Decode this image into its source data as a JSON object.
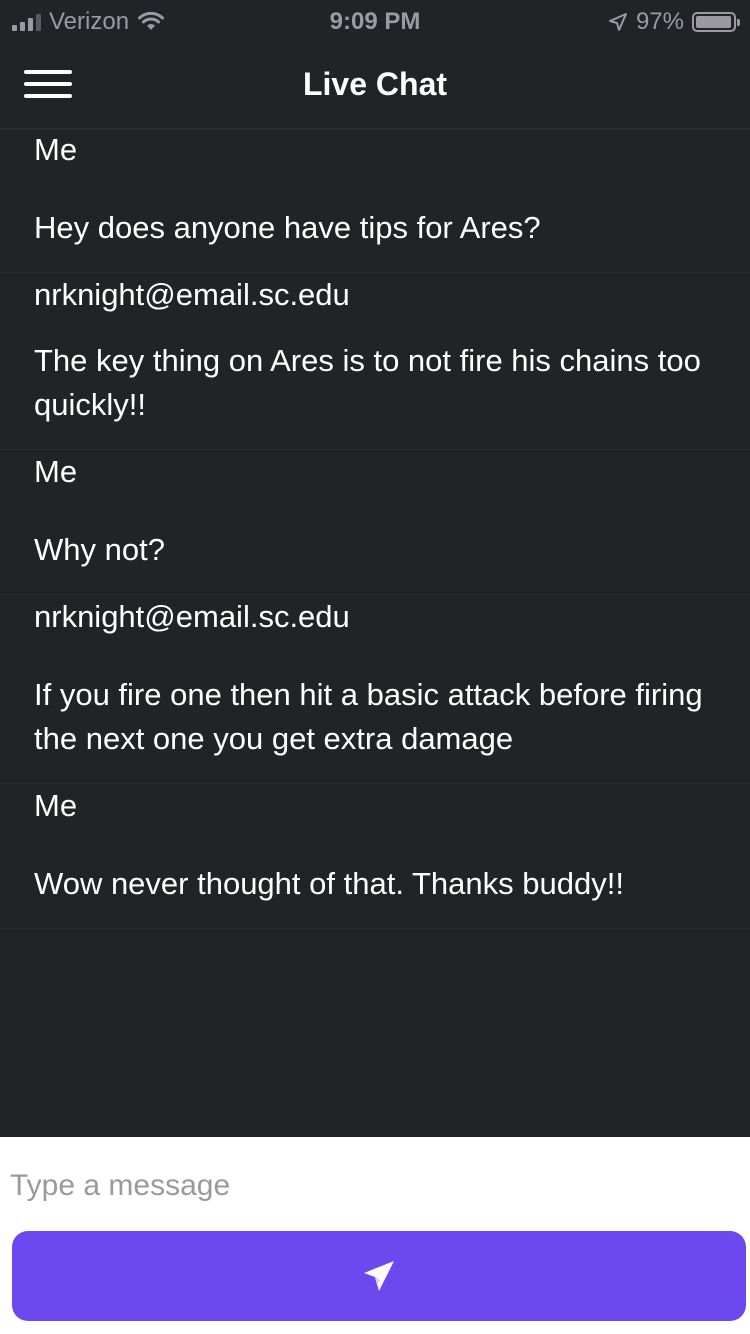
{
  "status_bar": {
    "carrier": "Verizon",
    "time": "9:09 PM",
    "battery": "97%",
    "battery_level": 0.97
  },
  "header": {
    "title": "Live Chat",
    "menu_icon": "hamburger-menu-icon"
  },
  "messages": [
    {
      "sender": "Me",
      "text": "Hey does anyone have tips for Ares?"
    },
    {
      "sender": "nrknight@email.sc.edu",
      "text": "The key thing on Ares is to not fire his chains too quickly!!"
    },
    {
      "sender": "Me",
      "text": "Why not?"
    },
    {
      "sender": "nrknight@email.sc.edu",
      "text": "If you fire one then hit a basic attack before firing the next one you get extra damage"
    },
    {
      "sender": "Me",
      "text": "Wow never thought of that. Thanks buddy!!"
    }
  ],
  "composer": {
    "placeholder": "Type a message",
    "value": "",
    "send_icon": "paper-plane-icon"
  },
  "colors": {
    "background": "#222327",
    "accent": "#6c48ef",
    "composer_background": "#ffffff"
  }
}
